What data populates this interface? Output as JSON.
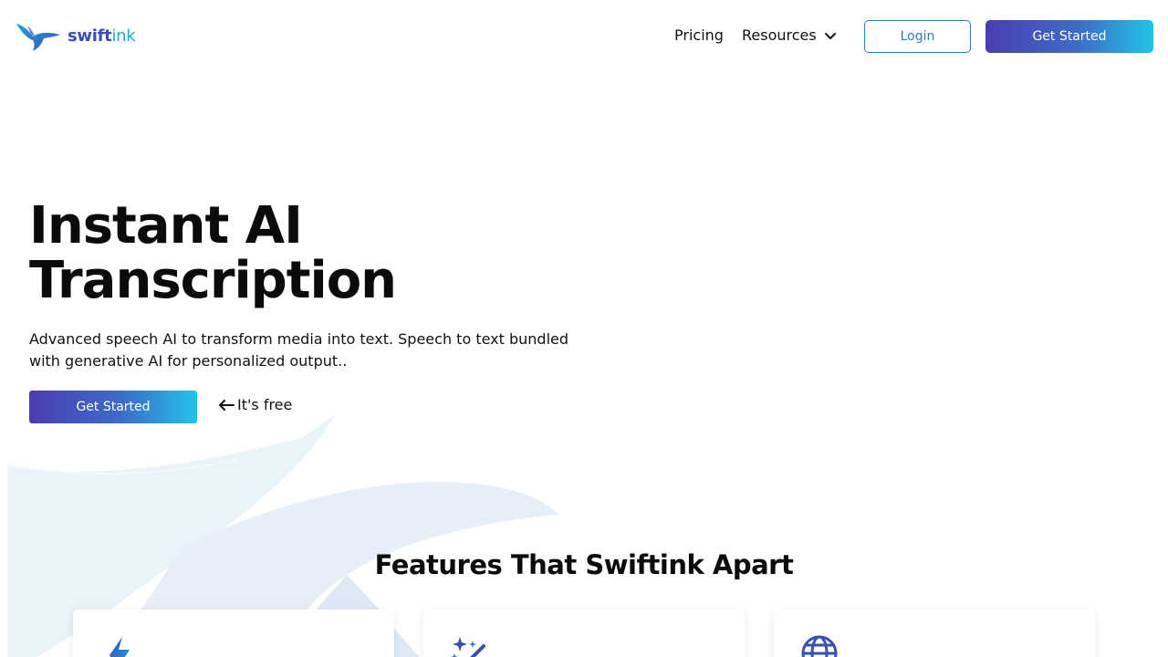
{
  "brand": {
    "name_part1": "swift",
    "name_part2": "ink",
    "logo_icon": "bird-logo-icon",
    "colors": {
      "primary": "#3a4fb5",
      "accent": "#1ea7d8",
      "gradient_start": "#4a3db0",
      "gradient_end": "#22c3e6"
    }
  },
  "nav": {
    "pricing_label": "Pricing",
    "resources_label": "Resources",
    "resources_icon": "chevron-down-icon",
    "login_label": "Login",
    "get_started_label": "Get Started"
  },
  "hero": {
    "title_line1": "Instant AI",
    "title_line2": "Transcription",
    "subtitle": "Advanced speech AI to transform media into text. Speech to text bundled with generative AI for personalized output..",
    "cta_label": "Get Started",
    "free_note": "It's free",
    "free_note_icon": "arrow-left-icon"
  },
  "features": {
    "title": "Features That Swiftink Apart",
    "cards": [
      {
        "icon": "lightning-icon"
      },
      {
        "icon": "sparkles-wand-icon"
      },
      {
        "icon": "globe-icon"
      }
    ]
  }
}
